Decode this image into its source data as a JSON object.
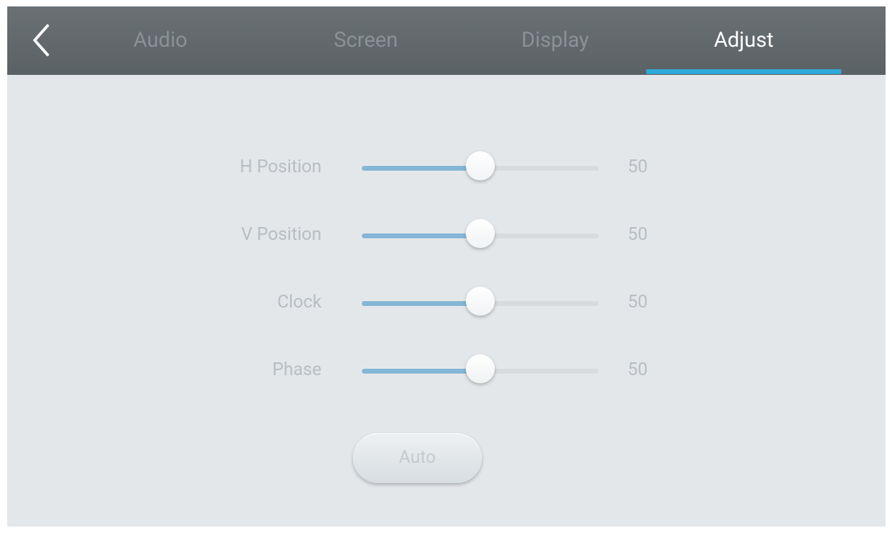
{
  "tabs": [
    {
      "label": "Audio"
    },
    {
      "label": "Screen"
    },
    {
      "label": "Display"
    },
    {
      "label": "Adjust"
    }
  ],
  "active_tab": "Adjust",
  "accent_color": "#2fa9d8",
  "back_icon": "chevron-left-icon",
  "settings": [
    {
      "label": "H Position",
      "value": "50",
      "fraction": 0.5
    },
    {
      "label": "V Position",
      "value": "50",
      "fraction": 0.5
    },
    {
      "label": "Clock",
      "value": "50",
      "fraction": 0.5
    },
    {
      "label": "Phase",
      "value": "50",
      "fraction": 0.5
    }
  ],
  "auto_button": {
    "label": "Auto"
  }
}
